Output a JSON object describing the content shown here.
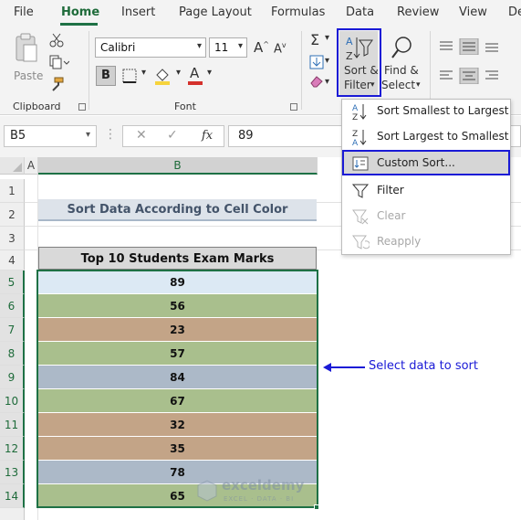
{
  "menu_tabs": [
    "File",
    "Home",
    "Insert",
    "Page Layout",
    "Formulas",
    "Data",
    "Review",
    "View",
    "De"
  ],
  "ribbon": {
    "clipboard": {
      "paste_label": "Paste",
      "group_label": "Clipboard"
    },
    "font": {
      "font_name": "Calibri",
      "font_size": "11",
      "bold_label": "B",
      "group_label": "Font"
    },
    "editing": {
      "sort_filter_label": "Sort &",
      "sort_filter_label2": "Filter",
      "find_select_label": "Find &",
      "find_select_label2": "Select"
    }
  },
  "formula_bar": {
    "name_box": "B5",
    "fx_label": "fx",
    "formula_value": "89"
  },
  "grid": {
    "columns": [
      "A",
      "B"
    ],
    "rows": [
      "1",
      "2",
      "3",
      "4",
      "5",
      "6",
      "7",
      "8",
      "9",
      "10",
      "11",
      "12",
      "13",
      "14"
    ],
    "title_cell": "Sort Data According to Cell Color",
    "table_header": "Top 10 Students Exam Marks",
    "marks": [
      {
        "value": "89",
        "color": "#dce9f4"
      },
      {
        "value": "56",
        "color": "#a9bf8d"
      },
      {
        "value": "23",
        "color": "#c3a487"
      },
      {
        "value": "57",
        "color": "#a9bf8d"
      },
      {
        "value": "84",
        "color": "#acb9c8"
      },
      {
        "value": "67",
        "color": "#a9bf8d"
      },
      {
        "value": "32",
        "color": "#c3a487"
      },
      {
        "value": "35",
        "color": "#c3a487"
      },
      {
        "value": "78",
        "color": "#acb9c8"
      },
      {
        "value": "65",
        "color": "#a9bf8d"
      }
    ]
  },
  "sort_menu": {
    "items": [
      {
        "label": "Sort Smallest to Largest",
        "enabled": true
      },
      {
        "label": "Sort Largest to Smallest",
        "enabled": true
      },
      {
        "label": "Custom Sort...",
        "enabled": true
      },
      {
        "label": "Filter",
        "enabled": true
      },
      {
        "label": "Clear",
        "enabled": false
      },
      {
        "label": "Reapply",
        "enabled": false
      }
    ]
  },
  "annotation": {
    "text": "Select data to sort"
  },
  "watermark": {
    "brand": "exceldemy",
    "tagline": "EXCEL · DATA · BI"
  },
  "colors": {
    "accent_green": "#1e7145",
    "highlight_blue": "#1a1ad6",
    "header_gray": "#d9d9d9"
  }
}
